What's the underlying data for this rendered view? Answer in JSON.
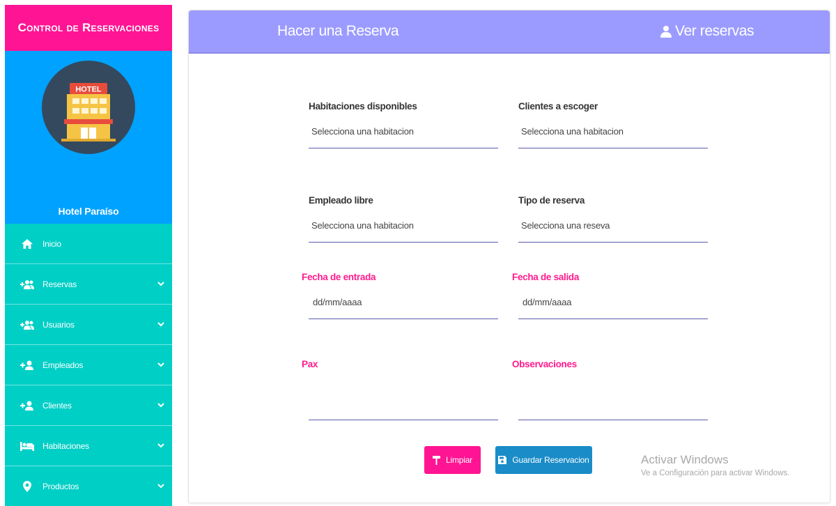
{
  "sidebar": {
    "brand": "Control de Reservaciones",
    "hotel_name": "Hotel Paraíso",
    "avatar_sign": "HOTEL",
    "items": [
      {
        "label": "Inicio",
        "icon": "home-icon"
      },
      {
        "label": "Reservas",
        "icon": "add-users-icon"
      },
      {
        "label": "Usuarios",
        "icon": "add-users-icon"
      },
      {
        "label": "Empleados",
        "icon": "add-user-icon"
      },
      {
        "label": "Clientes",
        "icon": "add-user-icon"
      },
      {
        "label": "Habitaciones",
        "icon": "bed-icon"
      },
      {
        "label": "Productos",
        "icon": "location-pin-icon"
      }
    ]
  },
  "tabs": {
    "make": "Hacer una Reserva",
    "view": "Ver reservas"
  },
  "form": {
    "rooms": {
      "label": "Habitaciones disponibles",
      "value": "Selecciona una habitacion"
    },
    "clients": {
      "label": "Clientes a escoger",
      "value": "Selecciona una habitacion"
    },
    "employee": {
      "label": "Empleado libre",
      "value": "Selecciona una habitacion"
    },
    "type": {
      "label": "Tipo de reserva",
      "value": "Selecciona una reseva"
    },
    "check_in": {
      "label": "Fecha de entrada",
      "value": "dd/mm/aaaa"
    },
    "check_out": {
      "label": "Fecha de salida",
      "value": "dd/mm/aaaa"
    },
    "pax": {
      "label": "Pax",
      "value": ""
    },
    "notes": {
      "label": "Observaciones",
      "value": ""
    }
  },
  "buttons": {
    "clear": "Limpiar",
    "save": "Guardar Reservacion"
  },
  "watermark": {
    "title": "Activar Windows",
    "subtitle": "Ve a Configuración para activar Windows."
  },
  "colors": {
    "brand_pink": "#ff1493",
    "profile_blue": "#00a2ff",
    "nav_teal": "#00cfc6",
    "header_lavender": "#9b9bff",
    "save_blue": "#1a8cc8"
  }
}
